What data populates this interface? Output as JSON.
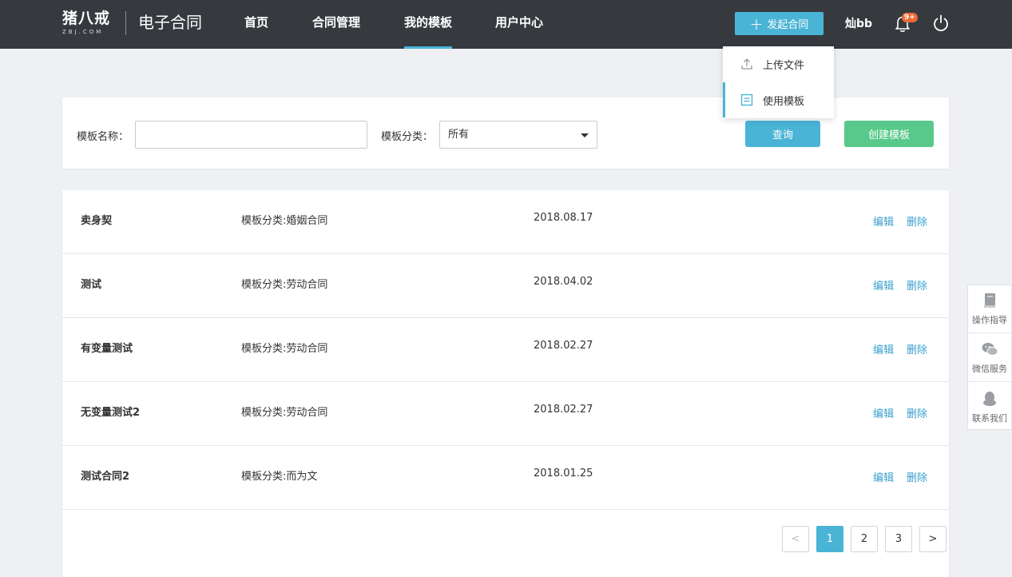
{
  "header": {
    "logo_main": "猪八戒",
    "logo_sub": "ZBJ.COM",
    "product_name": "电子合同",
    "nav": [
      "首页",
      "合同管理",
      "我的模板",
      "用户中心"
    ],
    "active_nav": "我的模板",
    "launch_button": "发起合同",
    "username": "灿bb",
    "notification_badge": "9+"
  },
  "dropdown": {
    "items": [
      "上传文件",
      "使用模板"
    ],
    "active_item": "使用模板"
  },
  "filter": {
    "name_label": "模板名称：",
    "name_value": "",
    "category_label": "模板分类：",
    "category_value": "所有",
    "query_button": "查询",
    "create_button": "创建模板"
  },
  "templates": [
    {
      "name": "卖身契",
      "category": "模板分类:婚姻合同",
      "date": "2018.08.17",
      "edit": "编辑",
      "delete": "删除"
    },
    {
      "name": "测试",
      "category": "模板分类:劳动合同",
      "date": "2018.04.02",
      "edit": "编辑",
      "delete": "删除"
    },
    {
      "name": "有变量测试",
      "category": "模板分类:劳动合同",
      "date": "2018.02.27",
      "edit": "编辑",
      "delete": "删除"
    },
    {
      "name": "无变量测试2",
      "category": "模板分类:劳动合同",
      "date": "2018.02.27",
      "edit": "编辑",
      "delete": "删除"
    },
    {
      "name": "测试合同2",
      "category": "模板分类:而为文",
      "date": "2018.01.25",
      "edit": "编辑",
      "delete": "删除"
    }
  ],
  "pagination": {
    "prev": "<",
    "pages": [
      "1",
      "2",
      "3"
    ],
    "current": "1",
    "next": ">"
  },
  "side_toolbar": [
    "操作指导",
    "微信服务",
    "联系我们"
  ],
  "colors": {
    "header_bg": "#363a3f",
    "accent": "#4ab4d6",
    "create_green": "#58c98a",
    "link_blue": "#3a9fcc",
    "badge_orange": "#f06a35"
  }
}
